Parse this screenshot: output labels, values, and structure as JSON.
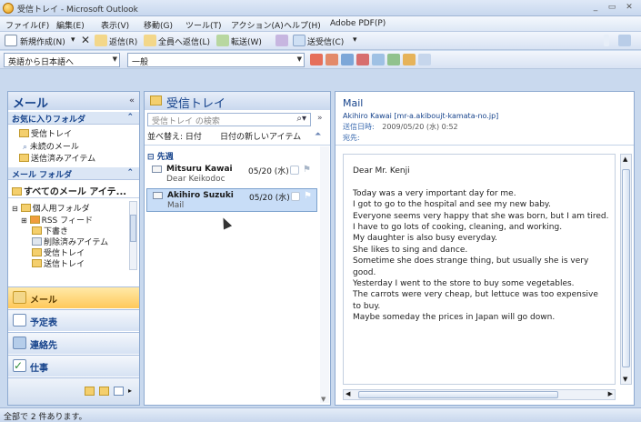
{
  "window": {
    "title": "受信トレイ - Microsoft Outlook"
  },
  "menu": [
    "ファイル(F)",
    "編集(E)",
    "表示(V)",
    "移動(G)",
    "ツール(T)",
    "アクション(A)",
    "ヘルプ(H)",
    "Adobe PDF(P)"
  ],
  "toolbar1": {
    "new": "新規作成(N)",
    "reply": "返信(R)",
    "reply_all": "全員へ返信(L)",
    "forward": "転送(W)",
    "send_receive": "送受信(C)"
  },
  "toolbar2": {
    "translate_combo": "英語から日本語へ",
    "general_combo": "一般"
  },
  "nav": {
    "header": "メール",
    "favorites_header": "お気に入りフォルダ",
    "favorites": [
      "受信トレイ",
      "未読のメール",
      "送信済みアイテム"
    ],
    "mailfolders_header": "メール フォルダ",
    "all_items": "すべてのメール アイテ...",
    "tree": [
      "個人用フォルダ",
      "RSS フィード",
      "下書き",
      "削除済みアイテム",
      "受信トレイ",
      "送信トレイ"
    ],
    "buttons": [
      "メール",
      "予定表",
      "連絡先",
      "仕事"
    ]
  },
  "list": {
    "header": "受信トレイ",
    "search_placeholder": "受信トレイ の検索",
    "sort_label": "並べ替え: 日付",
    "sort_order": "日付の新しいアイテム",
    "group": "先週",
    "messages": [
      {
        "from": "Mitsuru Kawai",
        "subject": "Dear Keikodoc",
        "date": "05/20 (水)"
      },
      {
        "from": "Akihiro Suzuki",
        "subject": "Mail",
        "date": "05/20 (水)"
      }
    ]
  },
  "reading": {
    "subject": "Mail",
    "from": "Akihiro Kawai [mr-a.akiboujt-kamata-no.jp]",
    "sent_label": "送信日時:",
    "sent_value": "2009/05/20 (水) 0:52",
    "to_label": "宛先:",
    "body": [
      "Dear Mr. Kenji",
      "",
      "Today was a very important day for me.",
      "I got to go to the hospital and see my new baby.",
      "Everyone seems very happy that she was born, but I am tired.",
      "I have to go lots of cooking, cleaning, and working.",
      "My daughter is also busy everyday.",
      "She likes to sing and dance.",
      "Sometime she does strange thing, but usually she is very",
      "good.",
      "Yesterday I went to the store to buy some vegetables.",
      "The carrots were very cheap, but lettuce was too expensive",
      "to buy.",
      "Maybe someday the prices in Japan will go down."
    ]
  },
  "status": "全部で 2 件あります。"
}
